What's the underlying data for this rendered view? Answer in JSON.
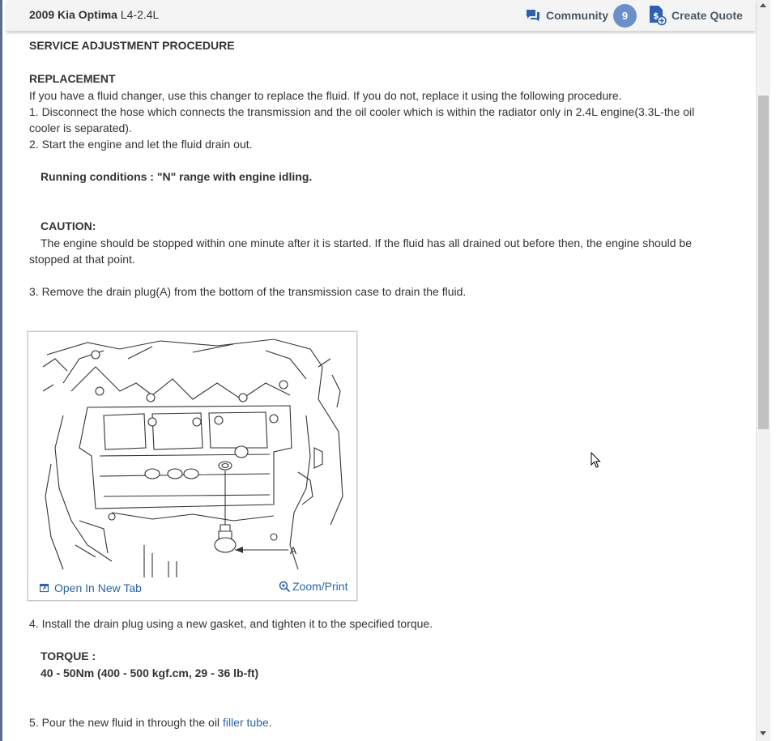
{
  "header": {
    "vehicle_name": "2009 Kia Optima",
    "engine": "L4-2.4L",
    "community_label": "Community",
    "community_count": "9",
    "create_quote_label": "Create Quote",
    "accent_color": "#6b8fc9"
  },
  "content": {
    "section_title": "SERVICE ADJUSTMENT PROCEDURE",
    "replacement_heading": "REPLACEMENT",
    "intro": "If you have a fluid changer, use this changer to replace the fluid. If you do not, replace it using the following procedure.",
    "step1_line1": " 1. Disconnect the hose which connects the transmission and the oil cooler which is within the radiator only in 2.4L engine(3.3L-the oil",
    "step1_line2": "cooler is separated).",
    "step2": " 2. Start the engine and let the fluid drain out.",
    "running_conditions": "Running conditions : \"N\" range with engine idling.",
    "caution_heading": "CAUTION:",
    "caution_line1": "The engine should be stopped within one minute after it is started. If the fluid has all drained out before then, the engine should be",
    "caution_line2": "stopped at that point.",
    "step3": " 3. Remove the drain plug(A) from the bottom of the transmission case to drain the fluid.",
    "figure": {
      "callout_label": "A",
      "open_new_tab_label": "Open In New Tab",
      "zoom_print_label": "Zoom/Print"
    },
    "step4": " 4. Install the drain plug using a new gasket, and tighten it to the specified torque.",
    "torque_heading": "TORQUE :",
    "torque_value": "40 - 50Nm (400 - 500 kgf.cm, 29 - 36 lb-ft)",
    "step5_prefix": " 5. Pour the new fluid in through the oil ",
    "step5_link": "filler tube",
    "step5_suffix": "."
  }
}
